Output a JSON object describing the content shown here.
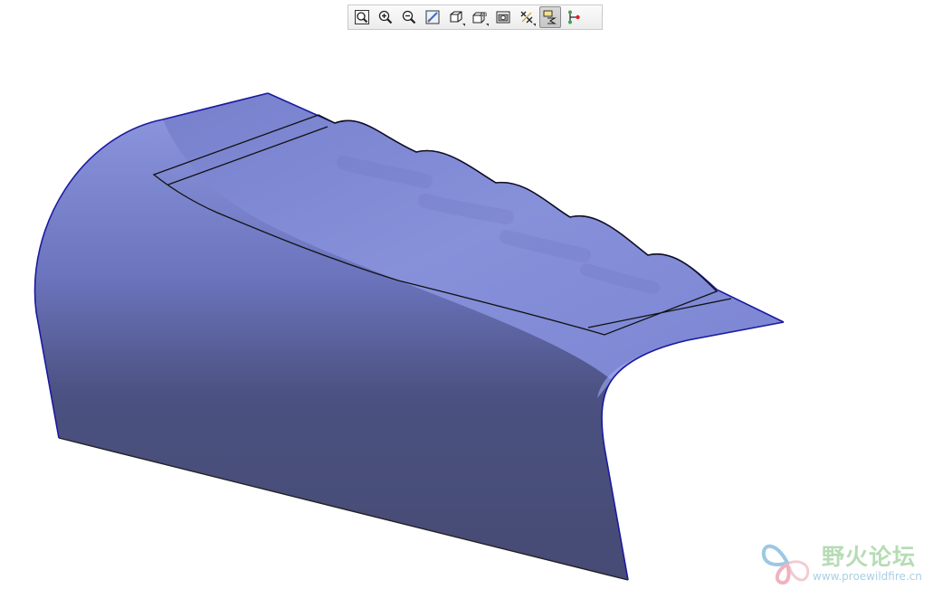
{
  "toolbar": {
    "buttons": [
      {
        "name": "refit-button",
        "icon": "zoom-fit-icon",
        "active": false,
        "flyout": false
      },
      {
        "name": "zoom-in-button",
        "icon": "zoom-in-icon",
        "active": false,
        "flyout": false
      },
      {
        "name": "zoom-out-button",
        "icon": "zoom-out-icon",
        "active": false,
        "flyout": false
      },
      {
        "name": "repaint-button",
        "icon": "repaint-icon",
        "active": false,
        "flyout": false
      },
      {
        "name": "display-style-button",
        "icon": "cube-icon",
        "active": false,
        "flyout": true
      },
      {
        "name": "saved-views-button",
        "icon": "saved-views-icon",
        "active": false,
        "flyout": true
      },
      {
        "name": "view-manager-button",
        "icon": "view-manager-icon",
        "active": false,
        "flyout": false
      },
      {
        "name": "datum-display-button",
        "icon": "datum-display-icon",
        "active": false,
        "flyout": true
      },
      {
        "name": "annotation-display-button",
        "icon": "annotation-display-icon",
        "active": true,
        "flyout": false
      },
      {
        "name": "spin-center-button",
        "icon": "spin-center-icon",
        "active": false,
        "flyout": false
      }
    ],
    "saved_views_glyph": "AB",
    "datum_glyph": "XX"
  },
  "model": {
    "surface_colors": {
      "top_light": "#8e98e0",
      "top_mid": "#7a84cf",
      "front_light": "#7e88d4",
      "front_dark": "#454a72",
      "edge": "#1a1aa0",
      "curve": "#111111"
    }
  },
  "watermark": {
    "title": "野火论坛",
    "url": "www.proewildfire.cn",
    "colors": {
      "title": "#b6dcb4",
      "url": "#a9cfe5",
      "logo_blue": "#9cc8e3",
      "logo_pink": "#efb3bf"
    }
  }
}
